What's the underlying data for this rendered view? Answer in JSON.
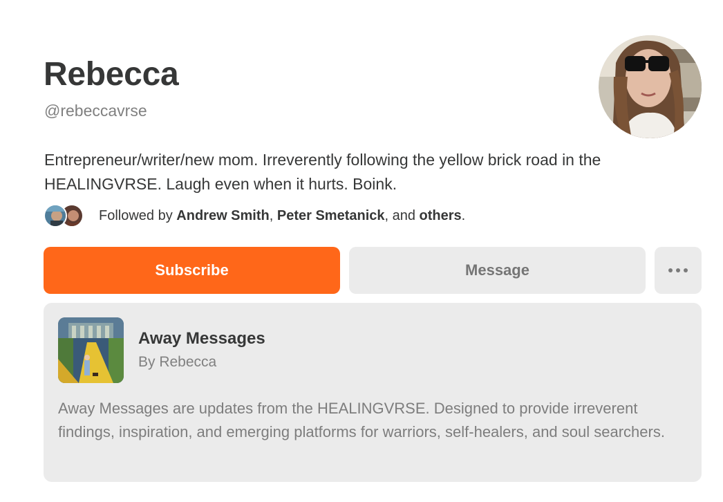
{
  "profile": {
    "name": "Rebecca",
    "handle": "@rebeccavrse",
    "bio": "Entrepreneur/writer/new mom. Irreverently following the yellow brick road in the HEALINGVRSE. Laugh even when it hurts. Boink."
  },
  "followed": {
    "prefix": "Followed by ",
    "user1": "Andrew Smith",
    "sep1": ", ",
    "user2": "Peter Smetanick",
    "sep2": ", and ",
    "others": "others",
    "suffix": "."
  },
  "actions": {
    "subscribe_label": "Subscribe",
    "message_label": "Message",
    "more_icon": "more-horizontal-icon"
  },
  "publication": {
    "name": "Away Messages",
    "byline": "By Rebecca",
    "description": "Away Messages are updates from the HEALINGVRSE. Designed to provide irreverent findings, inspiration, and emerging platforms for warriors, self-healers, and soul searchers."
  },
  "colors": {
    "accent": "#ff6719",
    "button_secondary": "#ebebeb",
    "card_background": "#ebebeb"
  }
}
